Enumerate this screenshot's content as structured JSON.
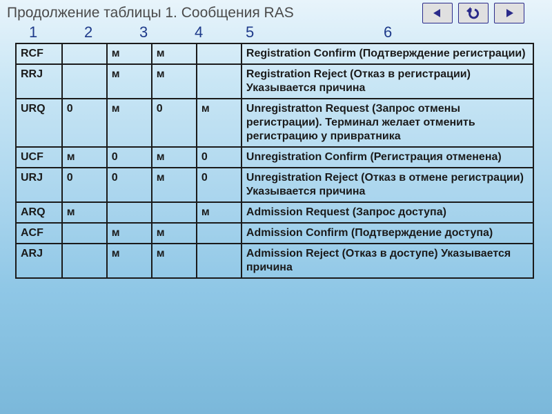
{
  "title": "Продолжение таблицы 1. Сообщения RAS",
  "numbers": [
    "1",
    "2",
    "3",
    "4",
    "5",
    "6"
  ],
  "rows": [
    {
      "code": "RCF",
      "c2": "",
      "c3": "м",
      "c4": "м",
      "c5": "",
      "desc": "Registration Confirm (Подтверждение регистрации)"
    },
    {
      "code": "RRJ",
      "c2": "",
      "c3": "м",
      "c4": "м",
      "c5": "",
      "desc": "Registration Reject (Отказ в регистрации) Указывается причина"
    },
    {
      "code": "URQ",
      "c2": "0",
      "c3": "м",
      "c4": "0",
      "c5": "м",
      "desc": "Unregistratton Request (Запрос отмены регистрации). Терминал желает отменить регистрацию у привратника"
    },
    {
      "code": "UCF",
      "c2": "м",
      "c3": "0",
      "c4": "м",
      "c5": "0",
      "desc": "Unregistration Confirm (Регистрация отменена)"
    },
    {
      "code": "URJ",
      "c2": "0",
      "c3": "0",
      "c4": "м",
      "c5": "0",
      "desc": "Unregistration Reject (Отказ в отмене регистрации) Указывается причина"
    },
    {
      "code": "ARQ",
      "c2": "м",
      "c3": "",
      "c4": "",
      "c5": "м",
      "desc": "Admission Request (Запрос доступа)"
    },
    {
      "code": "ACF",
      "c2": "",
      "c3": "м",
      "c4": "м",
      "c5": "",
      "desc": "Admission Confirm (Подтверждение доступа)"
    },
    {
      "code": "ARJ",
      "c2": "",
      "c3": "м",
      "c4": "м",
      "c5": "",
      "desc": "Admission Reject (Отказ в доступе) Указывается причина"
    }
  ]
}
